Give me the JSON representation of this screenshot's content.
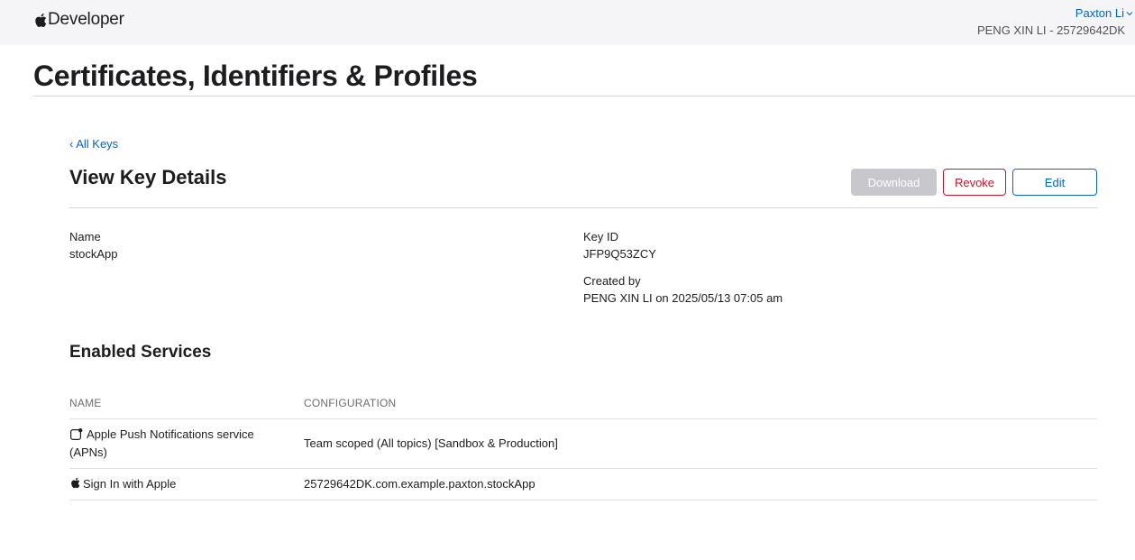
{
  "nav": {
    "brand": "Developer",
    "user_name": "Paxton Li",
    "team": "PENG XIN LI - 25729642DK"
  },
  "page": {
    "title": "Certificates, Identifiers & Profiles"
  },
  "key": {
    "back_link": "‹ All Keys",
    "section_title": "View Key Details",
    "buttons": {
      "download": "Download",
      "revoke": "Revoke",
      "edit": "Edit"
    },
    "fields": {
      "name_label": "Name",
      "name_value": "stockApp",
      "key_id_label": "Key ID",
      "key_id_value": "JFP9Q53ZCY",
      "created_by_label": "Created by",
      "created_by_value": "PENG XIN LI on 2025/05/13 07:05 am"
    }
  },
  "services": {
    "title": "Enabled Services",
    "columns": [
      "NAME",
      "CONFIGURATION"
    ],
    "rows": [
      {
        "icon": "notification-icon",
        "name_line1": "Apple Push Notifications service",
        "name_line2": "(APNs)",
        "configuration": "Team scoped (All topics) [Sandbox & Production]"
      },
      {
        "icon": "apple-logo-icon",
        "name": "Sign In with Apple",
        "configuration": "25729642DK.com.example.paxton.stockApp"
      }
    ]
  },
  "colors": {
    "link": "#0066cc",
    "danger": "#c9162b",
    "disabled": "#c7c7cc",
    "nav_bg": "#f5f5f7"
  }
}
